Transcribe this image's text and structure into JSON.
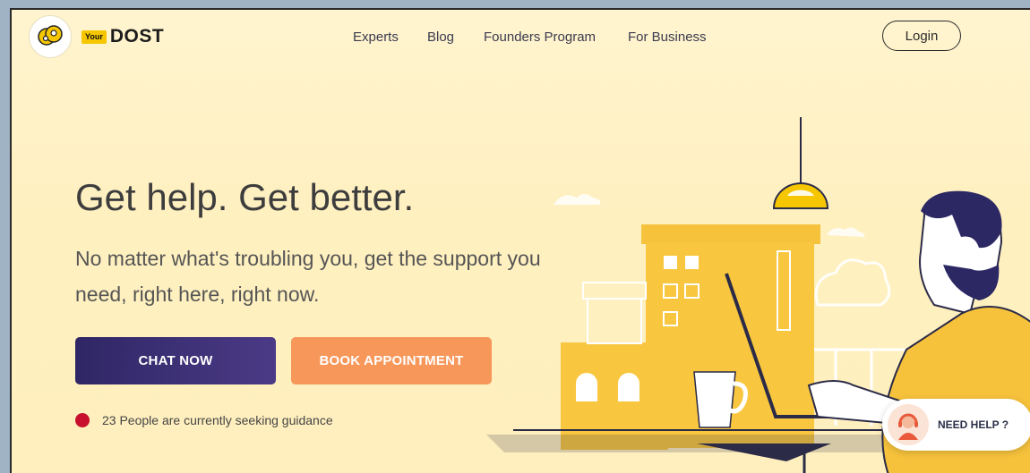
{
  "brand": {
    "logo_prefix": "Your",
    "logo_name": "DOST",
    "accent_yellow": "#f6c700"
  },
  "nav": {
    "items": [
      {
        "label": "Experts"
      },
      {
        "label": "Blog"
      },
      {
        "label": "Founders Program"
      },
      {
        "label": "For Business"
      }
    ],
    "login_label": "Login"
  },
  "hero": {
    "title": "Get help. Get better.",
    "subtitle": "No matter what's troubling you, get the support you need, right here, right now.",
    "chat_button": "CHAT NOW",
    "book_button": "BOOK APPOINTMENT",
    "chat_color": "#3a2f72",
    "book_color": "#f7975a",
    "status_text": "23 People are currently seeking guidance",
    "status_color": "#c8102e"
  },
  "help_widget": {
    "label": "NEED HELP ?"
  },
  "icons": [
    "logo-heads-icon",
    "headset-agent-icon",
    "status-dot-icon"
  ]
}
